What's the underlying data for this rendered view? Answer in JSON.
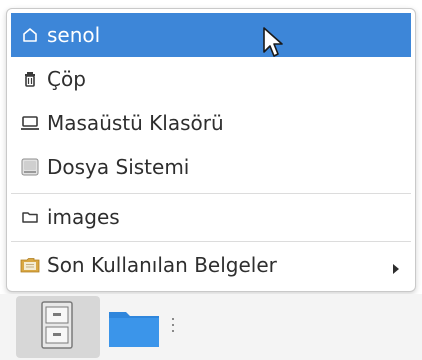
{
  "menu": {
    "items": [
      {
        "label": "senol",
        "icon": "home-icon",
        "selected": true
      },
      {
        "label": "Çöp",
        "icon": "trash-icon",
        "selected": false
      },
      {
        "label": "Masaüstü Klasörü",
        "icon": "desktop-icon",
        "selected": false
      },
      {
        "label": "Dosya Sistemi",
        "icon": "drive-icon",
        "selected": false
      },
      {
        "label": "images",
        "icon": "folder-outline-icon",
        "selected": false
      },
      {
        "label": "Son Kullanılan Belgeler",
        "icon": "folder-documents-icon",
        "selected": false,
        "submenu": true
      }
    ]
  },
  "taskbar": {
    "items": [
      {
        "icon": "file-cabinet-icon",
        "active": true
      },
      {
        "icon": "folder-icon",
        "active": false
      }
    ]
  },
  "colors": {
    "selection": "#3d86d8",
    "text": "#2e2e2e",
    "folder_blue": "#3b8fe0"
  }
}
